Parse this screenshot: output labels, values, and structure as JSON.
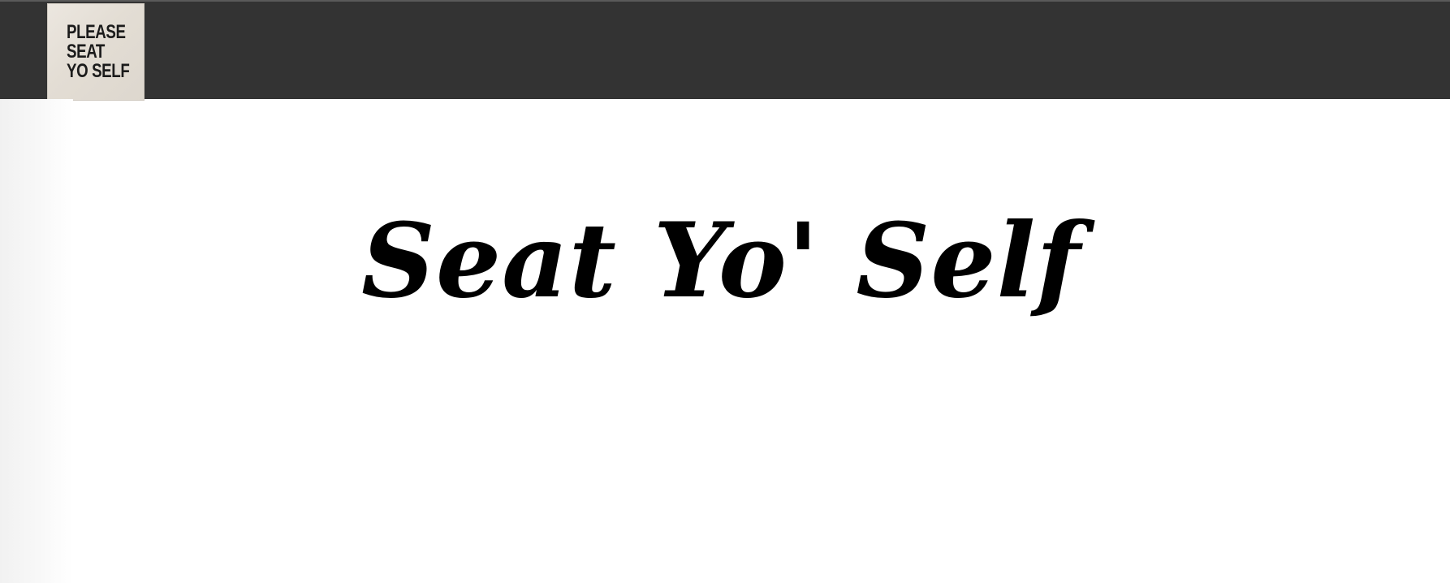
{
  "header": {
    "logo_lines": [
      "PLEASE",
      "SEAT",
      "YO SELF"
    ]
  },
  "main": {
    "title": "Seat Yo' Self"
  },
  "colors": {
    "header_bg": "#333333",
    "page_bg": "#ffffff",
    "title": "#000000"
  }
}
